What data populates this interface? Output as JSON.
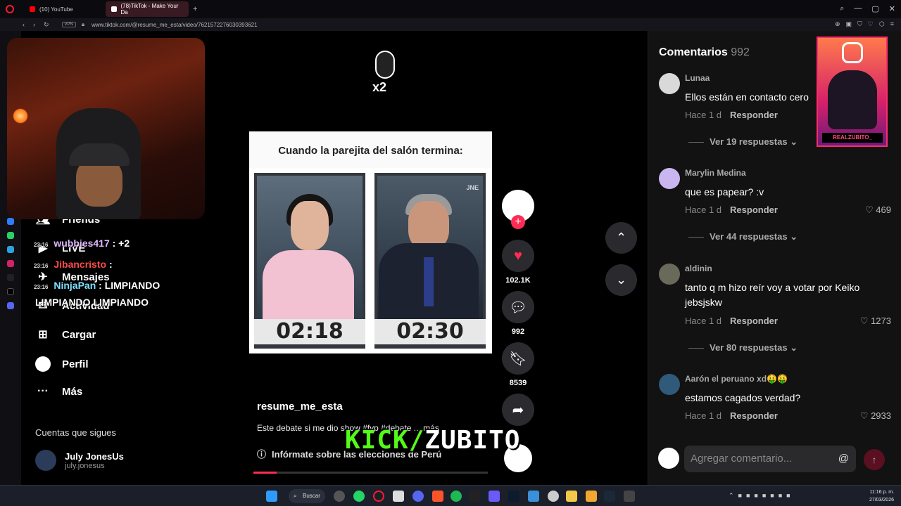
{
  "browser": {
    "tabs": [
      {
        "label": "(10) YouTube",
        "color": "#ff0000"
      },
      {
        "label": "(78)TikTok - Make Your Da",
        "color": "#ffffff"
      }
    ],
    "url": "www.tiktok.com/@resume_me_esta/video/7621572276030393621",
    "vpn": "VPN"
  },
  "sidenav": {
    "items": [
      {
        "label": "Friends",
        "icon": "friends-icon"
      },
      {
        "label": "LIVE",
        "icon": "live-icon"
      },
      {
        "label": "Mensajes",
        "icon": "messages-icon"
      },
      {
        "label": "Actividad",
        "icon": "activity-icon"
      },
      {
        "label": "Cargar",
        "icon": "upload-icon"
      },
      {
        "label": "Perfil",
        "icon": "profile-icon"
      },
      {
        "label": "Más",
        "icon": "more-icon"
      }
    ],
    "following_header": "Cuentas que sigues",
    "following": [
      {
        "name": "July JonesUs",
        "handle": "july.jonesus"
      }
    ]
  },
  "stream_chat": [
    {
      "time": "23:16",
      "user": "wubbies417",
      "msg": ": +2",
      "color": "#e0b8ff"
    },
    {
      "time": "23:16",
      "user": "Jibancristo",
      "msg": ":",
      "color": "#ff4a4a"
    },
    {
      "time": "23:16",
      "user": "NinjaPan",
      "msg": ":  LIMPIANDO",
      "color": "#7fe0ff"
    },
    {
      "time": "",
      "user": "",
      "msg": "LIMPIANDO   LIMPIANDO",
      "color": "#ffffff"
    }
  ],
  "video": {
    "caption": "Cuando la parejita del salón termina:",
    "left_time": "02:18",
    "right_time": "02:30",
    "watermark": "JNE",
    "sticker_label": "x2",
    "author": "resume_me_esta",
    "description": "Este debate si me dio show #fyp #debate ... más",
    "info_link": "Infórmate sobre las elecciones de Perú",
    "progress": 0.1
  },
  "actions": {
    "likes": "102.1K",
    "comments": "992",
    "saves": "8539",
    "like_color": "#fe2c55"
  },
  "overlay": {
    "kick_green": "KICK/",
    "kick_white": "ZUBITO",
    "instagram_tag": "REALZUBITO_"
  },
  "comments_panel": {
    "title": "Comentarios",
    "count": "992",
    "reply_label": "Responder",
    "comments": [
      {
        "user": "Lunaa",
        "text": "Ellos están en contacto cero",
        "time": "Hace 1 d",
        "likes": "",
        "replies": "Ver 19 respuestas",
        "avatar": "#d9d9d9"
      },
      {
        "user": "Marylin Medina",
        "text": "que es papear? :v",
        "time": "Hace 1 d",
        "likes": "469",
        "replies": "Ver 44 respuestas",
        "avatar": "#c9b6f0"
      },
      {
        "user": "aldinin",
        "text": "tanto q m hizo reír voy a votar por Keiko jebsjskw",
        "time": "Hace 1 d",
        "likes": "1273",
        "replies": "Ver 80 respuestas",
        "avatar": "#6a6a5a"
      },
      {
        "user": "Aarón el peruano xd🤑🤑",
        "text": "estamos cagados verdad?",
        "time": "Hace 1 d",
        "likes": "2933",
        "replies": "",
        "avatar": "#2f5a7a"
      }
    ],
    "input_placeholder": "Agregar comentario...",
    "at_symbol": "@"
  },
  "taskbar": {
    "search_label": "Buscar",
    "time": "11:16 p. m.",
    "date": "27/03/2026"
  }
}
